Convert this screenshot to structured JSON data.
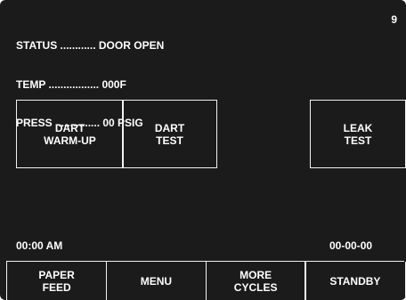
{
  "status": {
    "status_line": "STATUS ............ DOOR OPEN",
    "temp_line": "TEMP ................. 000F",
    "press_line": "PRESS ............... 00 PSIG"
  },
  "page_number": "9",
  "cycle_buttons": {
    "dart_warmup": [
      "DART",
      "WARM-UP"
    ],
    "dart_test": [
      "DART",
      "TEST"
    ],
    "leak_test": [
      "LEAK",
      "TEST"
    ]
  },
  "footer": {
    "time": "00:00 AM",
    "date": "00-00-00"
  },
  "soft_keys": {
    "paper_feed": [
      "PAPER",
      "FEED"
    ],
    "menu": [
      "MENU"
    ],
    "more_cycles": [
      "MORE",
      "CYCLES"
    ],
    "standby": [
      "STANDBY"
    ]
  }
}
